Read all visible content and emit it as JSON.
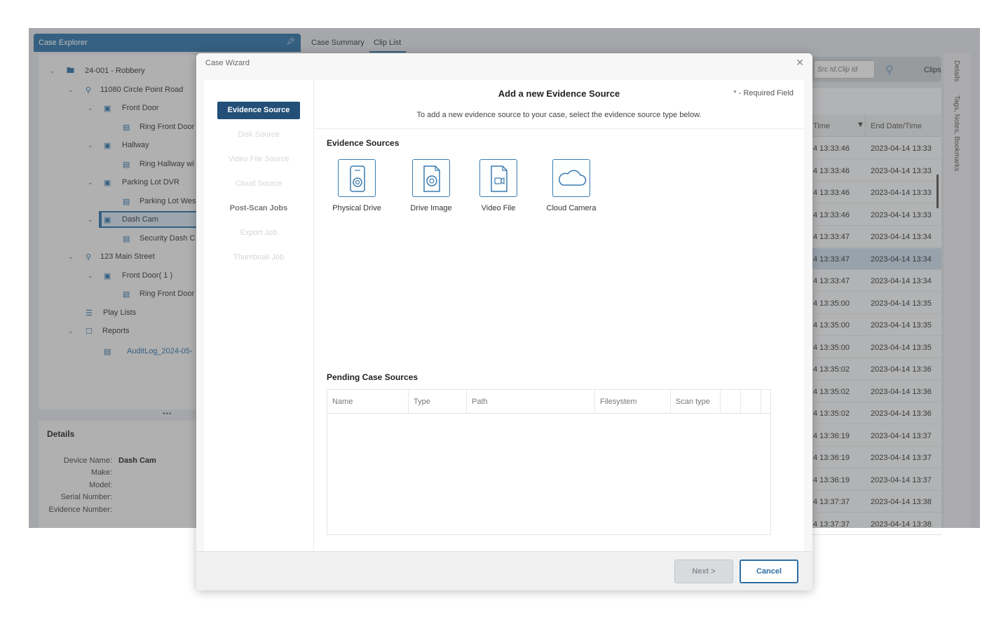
{
  "explorer": {
    "title": "Case Explorer",
    "tree": [
      {
        "label": "24-001 - Robbery",
        "icon": "folder-icon"
      },
      {
        "label": "11080 Circle Point Road",
        "icon": "location-pin-icon"
      },
      {
        "label": "Front Door",
        "icon": "camera-icon"
      },
      {
        "label": "Ring Front Door",
        "icon": "file-icon"
      },
      {
        "label": "Hallway",
        "icon": "camera-icon"
      },
      {
        "label": "Ring Hallway wi",
        "icon": "file-icon"
      },
      {
        "label": "Parking Lot DVR",
        "icon": "camera-icon"
      },
      {
        "label": "Parking Lot Wes",
        "icon": "file-icon"
      },
      {
        "label": "Dash Cam",
        "icon": "camera-icon"
      },
      {
        "label": "Security Dash C",
        "icon": "file-icon"
      },
      {
        "label": "123 Main Street",
        "icon": "location-pin-icon"
      },
      {
        "label": "Front Door( 1 )",
        "icon": "camera-icon"
      },
      {
        "label": "Ring Front Door",
        "icon": "file-icon"
      },
      {
        "label": "Play Lists",
        "icon": "list-icon"
      },
      {
        "label": "Reports",
        "icon": "document-icon"
      },
      {
        "label": "AuditLog_2024-05-",
        "icon": "pdf-icon"
      }
    ],
    "splitter": "•••"
  },
  "details": {
    "title": "Details",
    "fields": [
      {
        "label": "Device Name:",
        "value": "Dash Cam"
      },
      {
        "label": "Make:",
        "value": ""
      },
      {
        "label": "Model:",
        "value": ""
      },
      {
        "label": "Serial Number:",
        "value": ""
      },
      {
        "label": "Evidence Number:",
        "value": ""
      }
    ]
  },
  "tabs": {
    "case_summary": "Case Summary",
    "clip_list": "Clip List"
  },
  "search": {
    "placeholder": "Src Id,Clip Id",
    "clips_label": "Clips"
  },
  "grid": {
    "col_time": "Time",
    "col_end": "End Date/Time",
    "rows": [
      {
        "start": "4 13:33:46",
        "end": "2023-04-14 13:33"
      },
      {
        "start": "4 13:33:46",
        "end": "2023-04-14 13:33"
      },
      {
        "start": "4 13:33:46",
        "end": "2023-04-14 13:33"
      },
      {
        "start": "4 13:33:46",
        "end": "2023-04-14 13:33"
      },
      {
        "start": "4 13:33:47",
        "end": "2023-04-14 13:34"
      },
      {
        "start": "4 13:33:47",
        "end": "2023-04-14 13:34"
      },
      {
        "start": "4 13:33:47",
        "end": "2023-04-14 13:34"
      },
      {
        "start": "4 13:35:00",
        "end": "2023-04-14 13:35"
      },
      {
        "start": "4 13:35:00",
        "end": "2023-04-14 13:35"
      },
      {
        "start": "4 13:35:00",
        "end": "2023-04-14 13:35"
      },
      {
        "start": "4 13:35:02",
        "end": "2023-04-14 13:36"
      },
      {
        "start": "4 13:35:02",
        "end": "2023-04-14 13:36"
      },
      {
        "start": "4 13:35:02",
        "end": "2023-04-14 13:36"
      },
      {
        "start": "4 13:36:19",
        "end": "2023-04-14 13:37"
      },
      {
        "start": "4 13:36:19",
        "end": "2023-04-14 13:37"
      },
      {
        "start": "4 13:36:19",
        "end": "2023-04-14 13:37"
      },
      {
        "start": "4 13:37:37",
        "end": "2023-04-14 13:38"
      },
      {
        "start": "4 13:37:37",
        "end": "2023-04-14 13:38"
      }
    ]
  },
  "rail": {
    "details": "Details",
    "tags": "Tags, Notes, Bookmarks"
  },
  "wizard": {
    "title": "Case Wizard",
    "close": "✕",
    "steps": [
      "Evidence Source",
      "Disk Source",
      "Video File Source",
      "Cloud Source",
      "Post-Scan Jobs",
      "Export Job",
      "Thumbnail Job"
    ],
    "heading": "Add a new Evidence Source",
    "required_note": "* - Required Field",
    "description": "To add a new evidence source to your case, select the evidence source type below.",
    "evidence_heading": "Evidence Sources",
    "sources": [
      {
        "label": "Physical Drive",
        "icon": "physical-drive-icon"
      },
      {
        "label": "Drive Image",
        "icon": "drive-image-icon"
      },
      {
        "label": "Video File",
        "icon": "video-file-icon"
      },
      {
        "label": "Cloud Camera",
        "icon": "cloud-camera-icon"
      }
    ],
    "pending_heading": "Pending Case Sources",
    "pending_columns": [
      "Name",
      "Type",
      "Path",
      "Filesystem",
      "Scan type",
      "",
      ""
    ],
    "next": "Next >",
    "cancel": "Cancel"
  },
  "colors": {
    "accent": "#2d6fa3",
    "active_step": "#234f78",
    "highlight_row": "#c7d7e6"
  }
}
